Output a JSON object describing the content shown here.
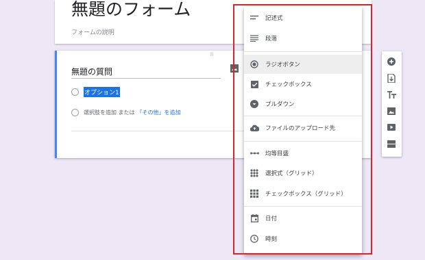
{
  "form": {
    "title": "無題のフォーム",
    "description": "フォームの説明"
  },
  "question": {
    "title": "無題の質問",
    "option1": "オプション1",
    "add_option": "選択肢を追加 または",
    "add_other": "「その他」を追加"
  },
  "menu": {
    "items": [
      {
        "label": "記述式",
        "icon": "short-answer-icon"
      },
      {
        "label": "段落",
        "icon": "paragraph-icon"
      },
      {
        "label": "ラジオボタン",
        "icon": "radio-button-icon"
      },
      {
        "label": "チェックボックス",
        "icon": "checkbox-icon"
      },
      {
        "label": "プルダウン",
        "icon": "dropdown-icon"
      },
      {
        "label": "ファイルのアップロード先",
        "icon": "upload-icon"
      },
      {
        "label": "均等目盛",
        "icon": "linear-scale-icon"
      },
      {
        "label": "選択式（グリッド）",
        "icon": "grid-icon"
      },
      {
        "label": "チェックボックス（グリッド）",
        "icon": "checkbox-grid-icon"
      },
      {
        "label": "日付",
        "icon": "date-icon"
      },
      {
        "label": "時刻",
        "icon": "time-icon"
      }
    ],
    "selected_index": 2
  },
  "toolbar": {
    "buttons": [
      "add-question-icon",
      "import-questions-icon",
      "add-title-icon",
      "add-image-icon",
      "add-video-icon",
      "add-section-icon"
    ]
  },
  "colors": {
    "accent": "#4285f4",
    "highlight_border": "#e0202a",
    "background": "#ede7f6"
  }
}
